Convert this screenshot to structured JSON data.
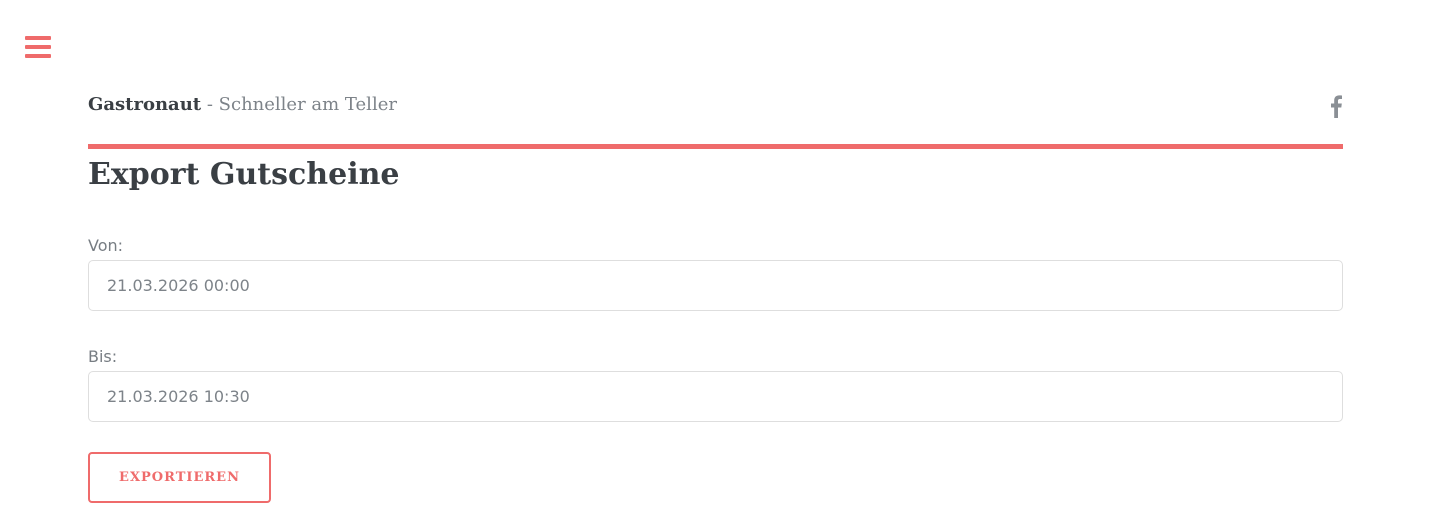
{
  "header": {
    "menu_icon": "hamburger-menu-icon",
    "brand_name": "Gastronaut",
    "brand_separator": " - ",
    "brand_tagline": "Schneller am Teller",
    "social_icon": "facebook-icon"
  },
  "colors": {
    "accent": "#ef6b6b",
    "text_dark": "#3a3f44",
    "text_muted": "#7d8389"
  },
  "main": {
    "title": "Export Gutscheine",
    "from_label": "Von:",
    "from_value": "21.03.2026 00:00",
    "to_label": "Bis:",
    "to_value": "21.03.2026 10:30",
    "export_button_label": "EXPORTIEREN"
  }
}
